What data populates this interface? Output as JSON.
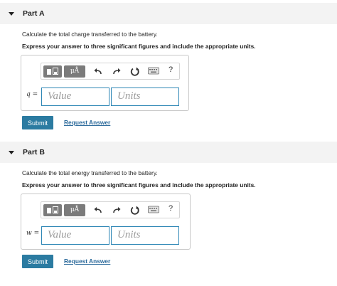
{
  "parts": [
    {
      "title": "Part A",
      "question": "Calculate the total charge transferred to the battery.",
      "instruction": "Express your answer to three significant figures and include the appropriate units.",
      "variable": "q =",
      "value_placeholder": "Value",
      "units_placeholder": "Units",
      "units_button": "μÅ",
      "help": "?",
      "submit": "Submit",
      "request": "Request Answer"
    },
    {
      "title": "Part B",
      "question": "Calculate the total energy transferred to the battery.",
      "instruction": "Express your answer to three significant figures and include the appropriate units.",
      "variable": "w =",
      "value_placeholder": "Value",
      "units_placeholder": "Units",
      "units_button": "μÅ",
      "help": "?",
      "submit": "Submit",
      "request": "Request Answer"
    }
  ],
  "icons": [
    "collapse-caret-icon",
    "templates-icon",
    "undo-icon",
    "redo-icon",
    "reset-icon",
    "keyboard-icon",
    "help-icon"
  ],
  "colors": {
    "accent": "#2b7ba1",
    "link": "#2d6b9c",
    "field_border": "#2d86b5",
    "header_bg": "#f3f3f3"
  }
}
